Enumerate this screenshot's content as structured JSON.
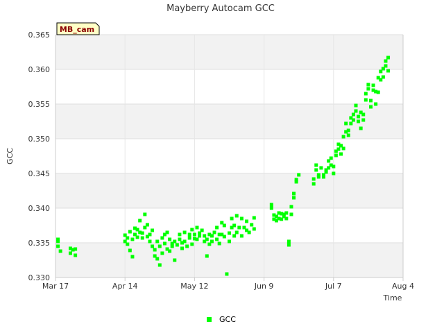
{
  "chart_data": {
    "type": "scatter",
    "title": "Mayberry Autocam GCC",
    "xlabel": "Time",
    "ylabel": "GCC",
    "badge": "MB_cam",
    "x_tick_labels": [
      "Mar 17",
      "Apr 14",
      "May 12",
      "Jun 9",
      "Jul 7",
      "Aug 4"
    ],
    "x_tick_days": [
      0,
      28,
      56,
      84,
      112,
      140
    ],
    "xlim_days": [
      0,
      140
    ],
    "y_ticks": [
      "0.330",
      "0.335",
      "0.340",
      "0.345",
      "0.350",
      "0.355",
      "0.360",
      "0.365"
    ],
    "ylim": [
      0.33,
      0.365
    ],
    "grid": true,
    "legend_position": "bottom-center",
    "series": [
      {
        "name": "GCC",
        "color": "#00ff00",
        "points": [
          [
            1,
            0.3355
          ],
          [
            1,
            0.3345
          ],
          [
            1,
            0.3352
          ],
          [
            2,
            0.3338
          ],
          [
            6,
            0.3342
          ],
          [
            6,
            0.3335
          ],
          [
            7,
            0.334
          ],
          [
            8,
            0.3332
          ],
          [
            8,
            0.3341
          ],
          [
            28,
            0.3352
          ],
          [
            28,
            0.3361
          ],
          [
            29,
            0.3348
          ],
          [
            29,
            0.3357
          ],
          [
            30,
            0.3339
          ],
          [
            30,
            0.3366
          ],
          [
            31,
            0.3355
          ],
          [
            31,
            0.333
          ],
          [
            32,
            0.3362
          ],
          [
            32,
            0.3371
          ],
          [
            33,
            0.3358
          ],
          [
            33,
            0.3369
          ],
          [
            34,
            0.3365
          ],
          [
            34,
            0.3382
          ],
          [
            35,
            0.3364
          ],
          [
            35,
            0.3357
          ],
          [
            36,
            0.3391
          ],
          [
            36,
            0.3372
          ],
          [
            37,
            0.3359
          ],
          [
            37,
            0.3376
          ],
          [
            38,
            0.3362
          ],
          [
            38,
            0.3352
          ],
          [
            39,
            0.3368
          ],
          [
            39,
            0.3345
          ],
          [
            40,
            0.334
          ],
          [
            40,
            0.3331
          ],
          [
            41,
            0.3327
          ],
          [
            41,
            0.3352
          ],
          [
            42,
            0.3318
          ],
          [
            42,
            0.3345
          ],
          [
            43,
            0.3357
          ],
          [
            43,
            0.3335
          ],
          [
            44,
            0.3349
          ],
          [
            44,
            0.3362
          ],
          [
            45,
            0.3365
          ],
          [
            45,
            0.3341
          ],
          [
            46,
            0.3338
          ],
          [
            46,
            0.3355
          ],
          [
            47,
            0.3349
          ],
          [
            47,
            0.3345
          ],
          [
            48,
            0.3325
          ],
          [
            48,
            0.3352
          ],
          [
            49,
            0.3347
          ],
          [
            50,
            0.3355
          ],
          [
            50,
            0.3362
          ],
          [
            51,
            0.3342
          ],
          [
            51,
            0.335
          ],
          [
            52,
            0.3352
          ],
          [
            52,
            0.3365
          ],
          [
            53,
            0.3345
          ],
          [
            54,
            0.3362
          ],
          [
            54,
            0.3357
          ],
          [
            55,
            0.3348
          ],
          [
            55,
            0.3369
          ],
          [
            56,
            0.3362
          ],
          [
            56,
            0.3356
          ],
          [
            57,
            0.3355
          ],
          [
            57,
            0.3372
          ],
          [
            58,
            0.336
          ],
          [
            58,
            0.3364
          ],
          [
            59,
            0.3368
          ],
          [
            60,
            0.3352
          ],
          [
            60,
            0.336
          ],
          [
            61,
            0.3331
          ],
          [
            61,
            0.3355
          ],
          [
            62,
            0.3348
          ],
          [
            62,
            0.3362
          ],
          [
            63,
            0.3352
          ],
          [
            63,
            0.336
          ],
          [
            64,
            0.3365
          ],
          [
            65,
            0.3355
          ],
          [
            65,
            0.3372
          ],
          [
            66,
            0.3362
          ],
          [
            66,
            0.3349
          ],
          [
            67,
            0.3362
          ],
          [
            67,
            0.3379
          ],
          [
            68,
            0.3359
          ],
          [
            68,
            0.3375
          ],
          [
            69,
            0.3305
          ],
          [
            70,
            0.3364
          ],
          [
            70,
            0.3352
          ],
          [
            71,
            0.3372
          ],
          [
            71,
            0.3385
          ],
          [
            72,
            0.3375
          ],
          [
            72,
            0.336
          ],
          [
            73,
            0.3365
          ],
          [
            73,
            0.3389
          ],
          [
            74,
            0.3372
          ],
          [
            75,
            0.3385
          ],
          [
            75,
            0.336
          ],
          [
            76,
            0.3372
          ],
          [
            77,
            0.3381
          ],
          [
            77,
            0.3368
          ],
          [
            78,
            0.3365
          ],
          [
            79,
            0.3376
          ],
          [
            80,
            0.337
          ],
          [
            80,
            0.3386
          ],
          [
            87,
            0.3405
          ],
          [
            87,
            0.34
          ],
          [
            88,
            0.339
          ],
          [
            88,
            0.3384
          ],
          [
            89,
            0.3382
          ],
          [
            89,
            0.3388
          ],
          [
            90,
            0.3385
          ],
          [
            90,
            0.3393
          ],
          [
            91,
            0.3392
          ],
          [
            91,
            0.3384
          ],
          [
            92,
            0.3391
          ],
          [
            92,
            0.3388
          ],
          [
            93,
            0.3385
          ],
          [
            93,
            0.3393
          ],
          [
            94,
            0.3352
          ],
          [
            94,
            0.3347
          ],
          [
            95,
            0.3391
          ],
          [
            95,
            0.3402
          ],
          [
            96,
            0.3415
          ],
          [
            96,
            0.3421
          ],
          [
            97,
            0.3438
          ],
          [
            97,
            0.3441
          ],
          [
            98,
            0.3448
          ],
          [
            104,
            0.3442
          ],
          [
            104,
            0.3435
          ],
          [
            105,
            0.3455
          ],
          [
            105,
            0.3462
          ],
          [
            106,
            0.3448
          ],
          [
            106,
            0.3445
          ],
          [
            107,
            0.3458
          ],
          [
            108,
            0.3448
          ],
          [
            108,
            0.3445
          ],
          [
            109,
            0.3455
          ],
          [
            109,
            0.3452
          ],
          [
            110,
            0.3458
          ],
          [
            110,
            0.3468
          ],
          [
            111,
            0.3472
          ],
          [
            111,
            0.3462
          ],
          [
            112,
            0.345
          ],
          [
            112,
            0.346
          ],
          [
            113,
            0.3476
          ],
          [
            113,
            0.3482
          ],
          [
            114,
            0.3485
          ],
          [
            114,
            0.3492
          ],
          [
            115,
            0.349
          ],
          [
            115,
            0.3478
          ],
          [
            116,
            0.3486
          ],
          [
            116,
            0.3503
          ],
          [
            117,
            0.351
          ],
          [
            117,
            0.3522
          ],
          [
            118,
            0.3505
          ],
          [
            118,
            0.3512
          ],
          [
            119,
            0.353
          ],
          [
            119,
            0.3522
          ],
          [
            120,
            0.3527
          ],
          [
            120,
            0.3535
          ],
          [
            121,
            0.354
          ],
          [
            121,
            0.3548
          ],
          [
            122,
            0.3532
          ],
          [
            122,
            0.3525
          ],
          [
            123,
            0.3515
          ],
          [
            123,
            0.3538
          ],
          [
            124,
            0.3535
          ],
          [
            124,
            0.3527
          ],
          [
            125,
            0.3556
          ],
          [
            125,
            0.3565
          ],
          [
            126,
            0.3572
          ],
          [
            126,
            0.3578
          ],
          [
            127,
            0.3555
          ],
          [
            127,
            0.3546
          ],
          [
            128,
            0.357
          ],
          [
            128,
            0.3577
          ],
          [
            129,
            0.3568
          ],
          [
            129,
            0.355
          ],
          [
            130,
            0.3588
          ],
          [
            130,
            0.3567
          ],
          [
            131,
            0.3585
          ],
          [
            131,
            0.3597
          ],
          [
            132,
            0.3589
          ],
          [
            132,
            0.3601
          ],
          [
            133,
            0.3605
          ],
          [
            133,
            0.3612
          ],
          [
            134,
            0.3598
          ],
          [
            134,
            0.3617
          ]
        ]
      }
    ]
  }
}
